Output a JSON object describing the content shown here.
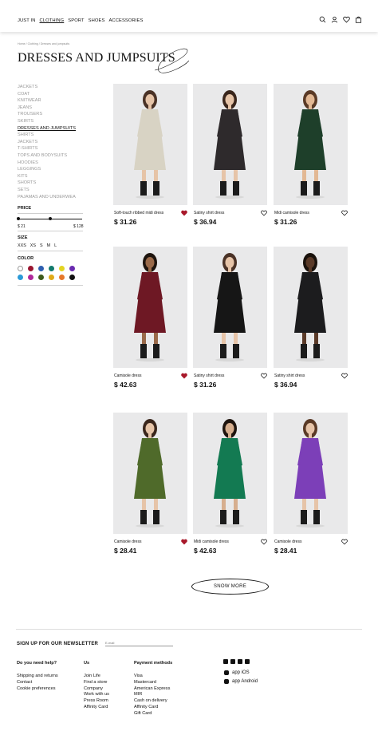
{
  "nav": [
    "JUST IN",
    "CLOTHING",
    "SPORT",
    "SHOES",
    "ACCESSORIES"
  ],
  "nav_active": "CLOTHING",
  "breadcrumb": "Home / Clothing / Dresses and jumpsuits",
  "page_title": "DRESSES AND JUMPSUITS",
  "categories": [
    "JACKETS",
    "COAT",
    "KNITWEAR",
    "JEANS",
    "TROUSERS",
    "SKIRTS",
    "DRESSES AND JUMPSUITS",
    "SHIRTS",
    "JACKETS",
    "T-SHIRTS",
    "TOPS AND BODYSUITS",
    "HOODIES",
    "LEGGINGS",
    "KITS",
    "SHORTS",
    "SETS",
    "PAJAMAS AND UNDERWEA"
  ],
  "selected_category": "DRESSES AND JUMPSUITS",
  "filters": {
    "price_label": "PRICE",
    "price_min": "$ 21",
    "price_max": "$ 128",
    "size_label": "SIZE",
    "sizes": [
      "XXS",
      "XS",
      "S",
      "M",
      "L"
    ],
    "color_label": "COLOR",
    "colors": [
      "#ffffff",
      "#9a1530",
      "#2e5fb0",
      "#137a6c",
      "#e3d422",
      "#6a2bb0",
      "#2a9ad8",
      "#b0279a",
      "#3d5a1c",
      "#e0aa18",
      "#e6782a",
      "#111111"
    ]
  },
  "products": [
    {
      "name": "Soft-touch ribbed midi dress",
      "price": "$ 31.26",
      "liked": true,
      "dress": "#d8d3c4",
      "skin": "#e6c4a8",
      "hair": "#4a3226"
    },
    {
      "name": "Satiny shirt dress",
      "price": "$ 36.94",
      "liked": false,
      "dress": "#2e2a2c",
      "skin": "#e6c4a8",
      "hair": "#3a261c"
    },
    {
      "name": "Midi camisole dress",
      "price": "$ 31.26",
      "liked": false,
      "dress": "#1e3f2a",
      "skin": "#e2b894",
      "hair": "#5a3a26"
    },
    {
      "name": "Camisole dress",
      "price": "$ 42.63",
      "liked": true,
      "dress": "#6e1824",
      "skin": "#9a6a4a",
      "hair": "#1e140e"
    },
    {
      "name": "Satiny shirt dress",
      "price": "$ 31.26",
      "liked": false,
      "dress": "#161616",
      "skin": "#e6c4a8",
      "hair": "#4a3226"
    },
    {
      "name": "Satiny shirt dress",
      "price": "$ 36.94",
      "liked": false,
      "dress": "#1c1c1e",
      "skin": "#5a3a28",
      "hair": "#1a120c"
    },
    {
      "name": "Camisole dress",
      "price": "$ 28.41",
      "liked": true,
      "dress": "#4f6a2a",
      "skin": "#e6c4a8",
      "hair": "#3a261c"
    },
    {
      "name": "Midi camisole dress",
      "price": "$ 42.63",
      "liked": false,
      "dress": "#137a52",
      "skin": "#d6ae8e",
      "hair": "#1e140e"
    },
    {
      "name": "Camisole dress",
      "price": "$ 28.41",
      "liked": false,
      "dress": "#7c3fb8",
      "skin": "#e6c4a8",
      "hair": "#5a3a26"
    }
  ],
  "show_more": "SNOW MORE",
  "newsletter": {
    "label": "SIGN UP FOR OUR NEWSLETTER",
    "placeholder": "E-mail"
  },
  "footer": {
    "help_title": "Do you need help?",
    "help": [
      "Shipping and returns",
      "Contact",
      "Cookie preferences"
    ],
    "us_title": "Us",
    "us": [
      "Join Life",
      "Find a store",
      "Company",
      "Work with us",
      "Press Room",
      "Affinity Card"
    ],
    "pay_title": "Payment methods",
    "pay": [
      "Visa",
      "Mastercard",
      "American Express",
      "MIR",
      "Cash on delivery",
      "Affinity Card",
      "Gift Card"
    ],
    "social": [
      "youtube-icon",
      "instagram-icon",
      "pinterest-icon",
      "facebook-icon"
    ],
    "app_ios": "app iOS",
    "app_android": "app Android"
  },
  "colors": {
    "text": "#111111",
    "muted": "#9a9a9a",
    "heart_filled": "#a8182a",
    "image_bg": "#e9e9ea"
  }
}
